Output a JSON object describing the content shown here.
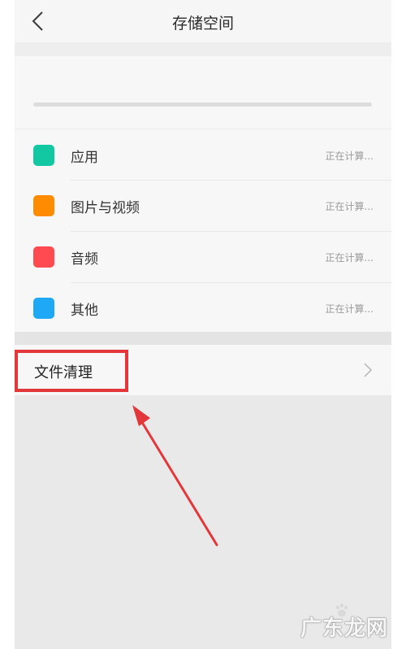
{
  "header": {
    "title": "存储空间",
    "back_icon": "chevron-left-icon"
  },
  "categories": [
    {
      "label": "应用",
      "status": "正在计算...",
      "color": "#12c8a3"
    },
    {
      "label": "图片与视频",
      "status": "正在计算...",
      "color": "#ff8c00"
    },
    {
      "label": "音频",
      "status": "正在计算...",
      "color": "#ff4a52"
    },
    {
      "label": "其他",
      "status": "正在计算...",
      "color": "#1fa8f5"
    }
  ],
  "cleanup": {
    "label": "文件清理",
    "chevron_icon": "chevron-right-icon"
  },
  "annotation": {
    "highlight_color": "#e2373b"
  },
  "watermark": {
    "text": "广东龙网"
  }
}
